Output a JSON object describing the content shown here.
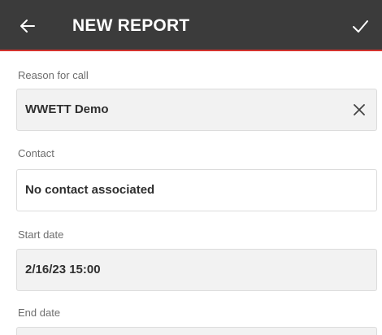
{
  "app_bar": {
    "title": "NEW REPORT",
    "back_icon": "arrow-left-icon",
    "save_icon": "check-icon"
  },
  "fields": {
    "reason": {
      "label": "Reason for call",
      "value": "WWETT Demo",
      "clear_icon": "close-icon"
    },
    "contact": {
      "label": "Contact",
      "value": "No contact associated"
    },
    "start_date": {
      "label": "Start date",
      "value": "2/16/23 15:00"
    },
    "end_date": {
      "label": "End date",
      "value": ""
    }
  },
  "colors": {
    "app_bar_bg": "#3b3b3b",
    "accent_line": "#d2322d",
    "readonly_field_bg": "#f2f2f2"
  }
}
